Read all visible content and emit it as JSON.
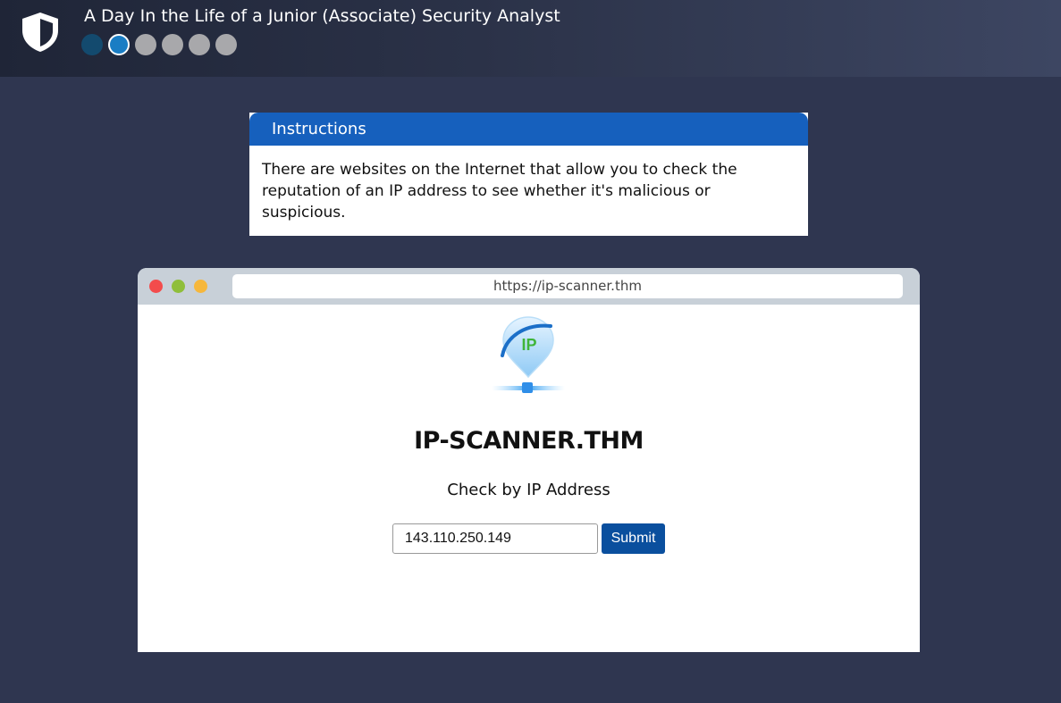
{
  "header": {
    "title": "A Day In the Life of a Junior (Associate) Security Analyst",
    "progress": {
      "total_steps": 6,
      "completed_steps": 1,
      "current_step": 2
    }
  },
  "instructions": {
    "heading": "Instructions",
    "body": "There are websites on the Internet that allow you to check the reputation of an IP address to see whether it's malicious or suspicious."
  },
  "browser": {
    "url": "https://ip-scanner.thm",
    "logo_text": "IP"
  },
  "site": {
    "title": "IP-SCANNER.THM",
    "check_label": "Check by IP Address",
    "ip_value": "143.110.250.149",
    "submit_label": "Submit"
  },
  "colors": {
    "accent": "#1660bd",
    "button": "#0a4f9e",
    "background": "#2f3650"
  }
}
